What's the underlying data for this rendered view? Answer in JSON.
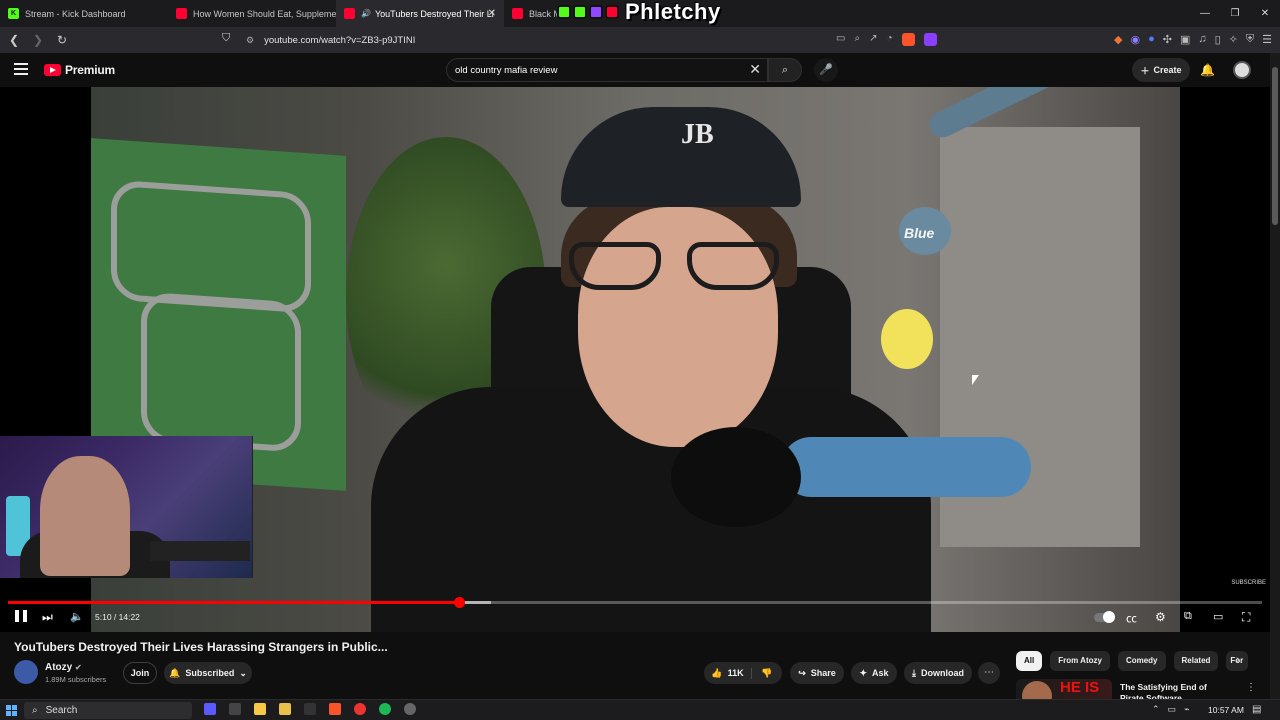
{
  "browser": {
    "tabs": [
      {
        "title": "Stream - Kick Dashboard",
        "fav_color": "#53fc18",
        "fav_letter": "K"
      },
      {
        "title": "How Women Should Eat, Supplemen",
        "fav_color": "#ff0033",
        "fav_letter": ""
      },
      {
        "title": "YouTubers Destroyed Their Li",
        "fav_color": "#ff0033",
        "fav_letter": "",
        "active": true
      },
      {
        "title": "Black Myth",
        "fav_color": "#ff0033",
        "fav_letter": ""
      }
    ],
    "overlay_logo": "Phletchy",
    "url": "youtube.com/watch?v=ZB3-p9JTINI"
  },
  "youtube": {
    "brand": "Premium",
    "search_value": "old country mafia review",
    "create_label": "Create"
  },
  "player": {
    "time": "5:10 / 14:22",
    "progress_fraction": 0.36,
    "buffered_fraction": 0.385,
    "subscribe_watermark": "SUBSCRIBE",
    "mic_brand": "Blue",
    "cap_logo": "JB"
  },
  "video": {
    "title": "YouTubers Destroyed Their Lives Harassing Strangers in Public...",
    "channel": "Atozy",
    "subscribers": "1.89M subscribers",
    "join_label": "Join",
    "subscribed_label": "Subscribed",
    "likes": "11K",
    "share_label": "Share",
    "ask_label": "Ask",
    "download_label": "Download"
  },
  "sidebar": {
    "chips": [
      "All",
      "From Atozy",
      "Comedy",
      "Related",
      "For"
    ],
    "recommended": {
      "title": "The Satisfying End of Pirate Software",
      "thumb_text": "HE IS"
    }
  },
  "taskbar": {
    "search_placeholder": "Search",
    "clock": "10:57 AM"
  },
  "colors": {
    "accent": "#ff0000",
    "background": "#0f0f0f"
  }
}
